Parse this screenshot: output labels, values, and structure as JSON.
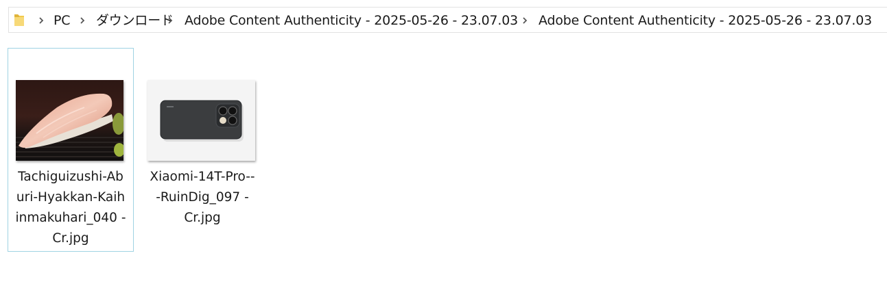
{
  "breadcrumb": {
    "items": [
      {
        "label": "PC"
      },
      {
        "label": "ダウンロード"
      },
      {
        "label": "Adobe Content Authenticity - 2025-05-26 - 23.07.03"
      },
      {
        "label": "Adobe Content Authenticity - 2025-05-26 - 23.07.03"
      }
    ]
  },
  "files": [
    {
      "name_lines": [
        "Tachiguizushi-Ab",
        "uri-Hyakkan-Kaih",
        "inmakuhari_040 -",
        "Cr.jpg"
      ],
      "selected": true,
      "thumbnail": "sushi-photo"
    },
    {
      "name_lines": [
        "Xiaomi-14T-Pro--",
        "-RuinDig_097 -",
        "Cr.jpg"
      ],
      "selected": false,
      "thumbnail": "phone-photo"
    }
  ],
  "colors": {
    "selection_border": "#9fd3e3",
    "folder_yellow": "#f2c94c",
    "text": "#1a1a1a"
  }
}
